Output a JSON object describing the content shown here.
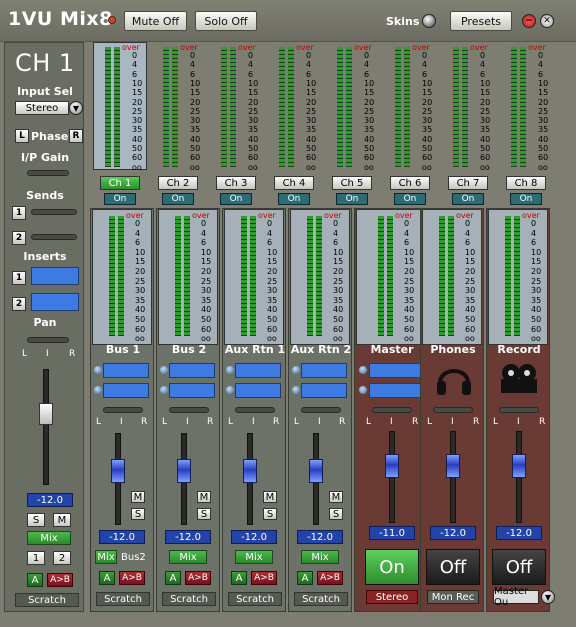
{
  "app": {
    "title": "1VU Mix8"
  },
  "toolbar": {
    "mute_label": "Mute Off",
    "solo_label": "Solo Off",
    "skins_label": "Skins",
    "presets_label": "Presets"
  },
  "channel": {
    "title": "CH 1",
    "input_sel_label": "Input Sel",
    "input_sel_value": "Stereo",
    "phase_label": "Phase",
    "phase_l": "L",
    "phase_r": "R",
    "ip_gain_label": "I/P Gain",
    "sends_label": "Sends",
    "send_nums": [
      "1",
      "2"
    ],
    "inserts_label": "Inserts",
    "insert_nums": [
      "1",
      "2"
    ],
    "pan_label": "Pan",
    "pan_l": "L",
    "pan_c": "I",
    "pan_r": "R",
    "level": "-12.0",
    "s_label": "S",
    "m_label": "M",
    "mix_label": "Mix",
    "bus1": "1",
    "bus2": "2",
    "a_label": "A",
    "ab_label": "A>B",
    "scratch_label": "Scratch"
  },
  "meter_scale": {
    "over": "over",
    "ticks": [
      "0",
      "4",
      "6",
      "10",
      "15",
      "20",
      "25",
      "30",
      "35",
      "40",
      "50",
      "60",
      "oo"
    ]
  },
  "input_channels": [
    {
      "name": "Ch 1",
      "on": "On",
      "selected": true
    },
    {
      "name": "Ch 2",
      "on": "On",
      "selected": false
    },
    {
      "name": "Ch 3",
      "on": "On",
      "selected": false
    },
    {
      "name": "Ch 4",
      "on": "On",
      "selected": false
    },
    {
      "name": "Ch 5",
      "on": "On",
      "selected": false
    },
    {
      "name": "Ch 6",
      "on": "On",
      "selected": false
    },
    {
      "name": "Ch 7",
      "on": "On",
      "selected": false
    },
    {
      "name": "Ch 8",
      "on": "On",
      "selected": false
    }
  ],
  "buses": [
    {
      "name": "Bus 1",
      "level": "-12.0",
      "route": "Mix",
      "route2": "Bus2",
      "scratch": "Scratch",
      "m": "M",
      "s": "S",
      "a": "A",
      "ab": "A>B"
    },
    {
      "name": "Bus 2",
      "level": "-12.0",
      "route": "Mix",
      "scratch": "Scratch",
      "m": "M",
      "s": "S",
      "a": "A",
      "ab": "A>B"
    },
    {
      "name": "Aux Rtn 1",
      "level": "-12.0",
      "route": "Mix",
      "scratch": "Scratch",
      "m": "M",
      "s": "S",
      "a": "A",
      "ab": "A>B"
    },
    {
      "name": "Aux Rtn 2",
      "level": "-12.0",
      "route": "Mix",
      "scratch": "Scratch",
      "m": "M",
      "s": "S",
      "a": "A",
      "ab": "A>B"
    }
  ],
  "outputs": [
    {
      "name": "Master",
      "level": "-11.0",
      "state": "On",
      "sub": "Stereo"
    },
    {
      "name": "Phones",
      "level": "-12.0",
      "state": "Off",
      "sub": "Mon Rec"
    },
    {
      "name": "Record",
      "level": "-12.0",
      "state": "Off",
      "sub": "Master Ou"
    }
  ],
  "pan_lcr": {
    "l": "L",
    "c": "I",
    "r": "R"
  }
}
